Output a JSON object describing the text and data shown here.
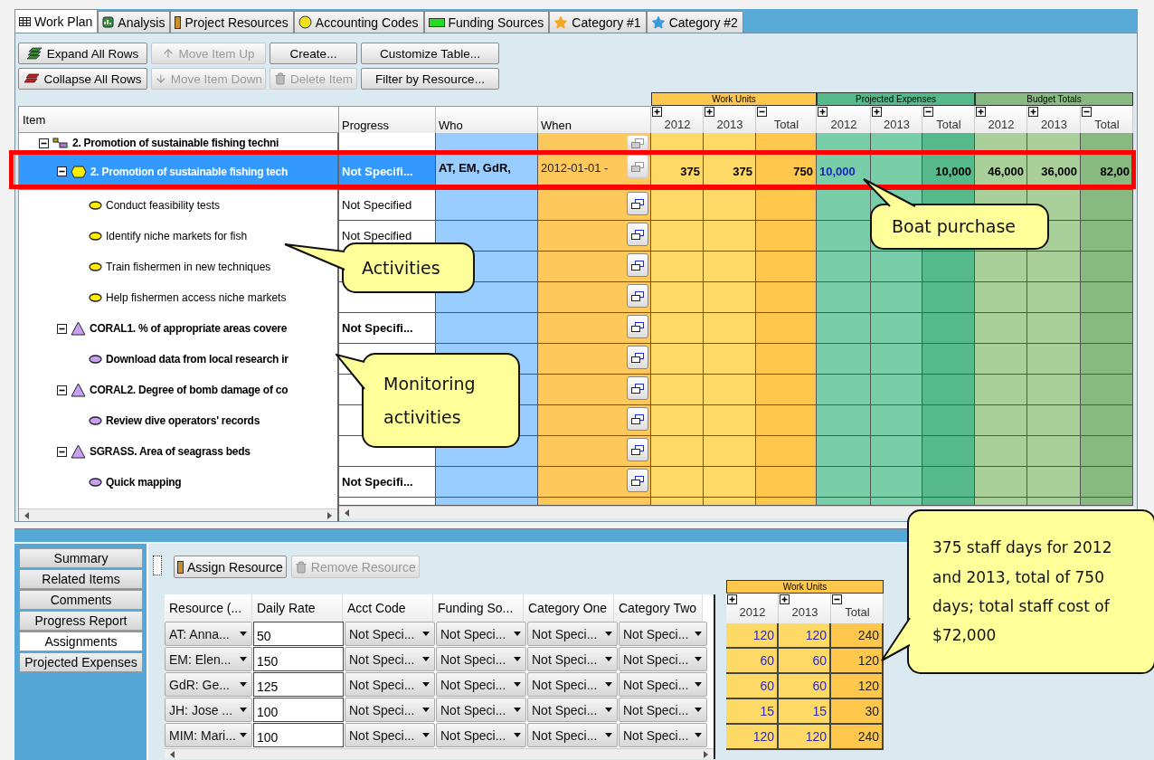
{
  "tabs": [
    {
      "label": "Work Plan",
      "kind": "table",
      "selected": true
    },
    {
      "label": "Analysis",
      "kind": "chart",
      "selected": false
    },
    {
      "label": "Project Resources",
      "kind": "bar",
      "selected": false
    },
    {
      "label": "Accounting Codes",
      "kind": "circle",
      "selected": false
    },
    {
      "label": "Funding Sources",
      "kind": "rect",
      "selected": false
    },
    {
      "label": "Category #1",
      "kind": "star",
      "color": "#f5a623",
      "selected": false
    },
    {
      "label": "Category #2",
      "kind": "star",
      "color": "#3a9ad9",
      "selected": false
    }
  ],
  "toolbar": [
    {
      "label": "Expand All Rows",
      "kind": "expand",
      "disabled": false
    },
    {
      "label": "Move Item Up",
      "kind": "up",
      "disabled": true
    },
    {
      "label": "Create...",
      "kind": "plain",
      "disabled": false
    },
    {
      "label": "Customize Table...",
      "kind": "plain",
      "disabled": false
    },
    {
      "label": "Collapse All Rows",
      "kind": "collapse",
      "disabled": false
    },
    {
      "label": "Move Item Down",
      "kind": "down",
      "disabled": true
    },
    {
      "label": "Delete Item",
      "kind": "trash",
      "disabled": true
    },
    {
      "label": "Filter by Resource...",
      "kind": "plain",
      "disabled": false
    }
  ],
  "work_plan": {
    "item_header": "Item",
    "columns": [
      "Progress",
      "Who",
      "When"
    ],
    "groups": [
      {
        "label": "Work Units",
        "kind": "work",
        "columns": [
          {
            "label": "2012",
            "kind": "year",
            "expanded": false
          },
          {
            "label": "2013",
            "kind": "year",
            "expanded": false
          },
          {
            "label": "Total",
            "kind": "total",
            "expanded": true
          }
        ]
      },
      {
        "label": "Projected Expenses",
        "kind": "expense",
        "columns": [
          {
            "label": "2012",
            "kind": "year",
            "expanded": false
          },
          {
            "label": "2013",
            "kind": "year",
            "expanded": false
          },
          {
            "label": "Total",
            "kind": "total",
            "expanded": true
          }
        ]
      },
      {
        "label": "Budget Totals",
        "kind": "budget",
        "columns": [
          {
            "label": "2012",
            "kind": "year",
            "expanded": false
          },
          {
            "label": "2013",
            "kind": "year",
            "expanded": false
          },
          {
            "label": "Total",
            "kind": "total",
            "expanded": true
          }
        ]
      }
    ],
    "rows": [
      {
        "label": "2. Promotion of sustainable fishing techni",
        "kind": "objective",
        "expanded": true,
        "selected": false,
        "details_enabled": false,
        "children": [
          {
            "label": "2. Promotion of sustainable fishing tech",
            "kind": "strategy",
            "expanded": true,
            "selected": true,
            "details_enabled": false,
            "progress": "Not Specifi...",
            "who": "AT, EM, GdR,",
            "when": "2012-01-01 -",
            "values": [
              {
                "text": "375",
                "entered": false
              },
              {
                "text": "375",
                "entered": false
              },
              {
                "text": "750",
                "entered": false
              },
              {
                "text": "10,000",
                "entered": true
              },
              {
                "entered": true
              },
              {
                "text": "10,000",
                "entered": false
              },
              {
                "text": "46,000",
                "entered": false
              },
              {
                "text": "36,000",
                "entered": false
              },
              {
                "text": "82,00",
                "entered": false
              }
            ],
            "children": [
              {
                "label": "Conduct feasibility tests",
                "kind": "activity",
                "selected": false,
                "details_enabled": true,
                "progress": "Not Specified"
              },
              {
                "label": "Identify niche markets for fish",
                "kind": "activity",
                "selected": false,
                "details_enabled": true,
                "progress": "Not Specified"
              },
              {
                "label": "Train fishermen in new techniques",
                "kind": "activity",
                "selected": false,
                "details_enabled": true
              },
              {
                "label": "Help fishermen access niche markets",
                "kind": "activity",
                "selected": false,
                "details_enabled": true
              }
            ]
          },
          {
            "label": "CORAL1. % of appropriate areas covere",
            "kind": "indicator",
            "expanded": true,
            "selected": false,
            "details_enabled": true,
            "progress": "Not Specifi...",
            "children": [
              {
                "label": "Download data from local research ir",
                "kind": "method",
                "selected": false,
                "details_enabled": true
              }
            ]
          },
          {
            "label": "CORAL2. Degree of bomb damage of co",
            "kind": "indicator",
            "expanded": true,
            "selected": false,
            "details_enabled": true,
            "children": [
              {
                "label": "Review dive operators' records",
                "kind": "method",
                "selected": false,
                "details_enabled": true
              }
            ]
          },
          {
            "label": "SGRASS. Area of seagrass beds",
            "kind": "indicator",
            "expanded": true,
            "selected": false,
            "details_enabled": true,
            "children": [
              {
                "label": "Quick mapping",
                "kind": "method",
                "selected": false,
                "details_enabled": true,
                "progress": "Not Specifi..."
              }
            ]
          }
        ]
      }
    ]
  },
  "detail_tabs": [
    {
      "label": "Summary",
      "selected": false
    },
    {
      "label": "Related Items",
      "selected": false
    },
    {
      "label": "Comments",
      "selected": false
    },
    {
      "label": "Progress Report",
      "selected": false
    },
    {
      "label": "Assignments",
      "selected": true
    },
    {
      "label": "Projected Expenses",
      "selected": false
    }
  ],
  "assignment_toolbar": [
    {
      "label": "Assign Resource",
      "kind": "resource",
      "disabled": false
    },
    {
      "label": "Remove Resource",
      "kind": "trash",
      "disabled": true
    }
  ],
  "assignments": {
    "columns": [
      "Resource (...",
      "Daily Rate",
      "Acct Code",
      "Funding So...",
      "Category One",
      "Category Two"
    ],
    "rows": [
      {
        "resource": "AT: Anna...",
        "rate": "50",
        "acct_code": "Not Speci...",
        "funding_source": "Not Speci...",
        "category_one": "Not Speci...",
        "category_two": "Not Speci..."
      },
      {
        "resource": "EM: Elen...",
        "rate": "150",
        "acct_code": "Not Speci...",
        "funding_source": "Not Speci...",
        "category_one": "Not Speci...",
        "category_two": "Not Speci..."
      },
      {
        "resource": "GdR: Ge...",
        "rate": "125",
        "acct_code": "Not Speci...",
        "funding_source": "Not Speci...",
        "category_one": "Not Speci...",
        "category_two": "Not Speci..."
      },
      {
        "resource": "JH: Jose ...",
        "rate": "100",
        "acct_code": "Not Speci...",
        "funding_source": "Not Speci...",
        "category_one": "Not Speci...",
        "category_two": "Not Speci..."
      },
      {
        "resource": "MIM: Mari...",
        "rate": "100",
        "acct_code": "Not Speci...",
        "funding_source": "Not Speci...",
        "category_one": "Not Speci...",
        "category_two": "Not Speci..."
      }
    ]
  },
  "work_units": {
    "title": "Work Units",
    "columns": [
      {
        "label": "2012",
        "kind": "year",
        "expanded": false
      },
      {
        "label": "2013",
        "kind": "year",
        "expanded": false
      },
      {
        "label": "Total",
        "kind": "total",
        "expanded": true
      }
    ],
    "rows": [
      [
        "120",
        "120",
        "240"
      ],
      [
        "60",
        "60",
        "120"
      ],
      [
        "60",
        "60",
        "120"
      ],
      [
        "15",
        "15",
        "30"
      ],
      [
        "120",
        "120",
        "240"
      ]
    ]
  },
  "callouts": [
    {
      "text": "Activities"
    },
    {
      "text": "Boat purchase"
    },
    {
      "text": "Monitoring activities"
    },
    {
      "text": "375 staff days for 2012 and 2013, total of 750 days; total staff cost of $72,000"
    }
  ]
}
